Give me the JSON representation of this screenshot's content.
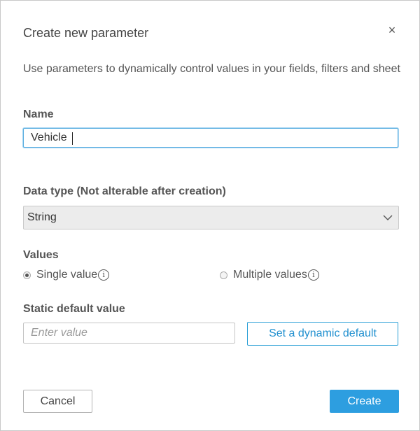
{
  "dialog": {
    "title": "Create new parameter",
    "close_icon": "close-icon",
    "close_glyph": "×",
    "description": "Use parameters to dynamically control values in your fields, filters and sheet"
  },
  "name": {
    "label": "Name",
    "value": "Vehicle"
  },
  "data_type": {
    "label": "Data type (Not alterable after creation)",
    "selected": "String",
    "icon": "chevron-down-icon"
  },
  "values": {
    "label": "Values",
    "options": [
      {
        "label": "Single value",
        "selected": true,
        "info_icon": "info-icon",
        "info_glyph": "i"
      },
      {
        "label": "Multiple values",
        "selected": false,
        "info_icon": "info-icon",
        "info_glyph": "i"
      }
    ]
  },
  "static_default": {
    "label": "Static default value",
    "placeholder": "Enter value",
    "value": "",
    "dynamic_button": "Set a dynamic default"
  },
  "footer": {
    "cancel_label": "Cancel",
    "create_label": "Create"
  },
  "colors": {
    "accent": "#2d9ee0",
    "focus_border": "#5aaee0",
    "select_bg": "#ececec"
  }
}
